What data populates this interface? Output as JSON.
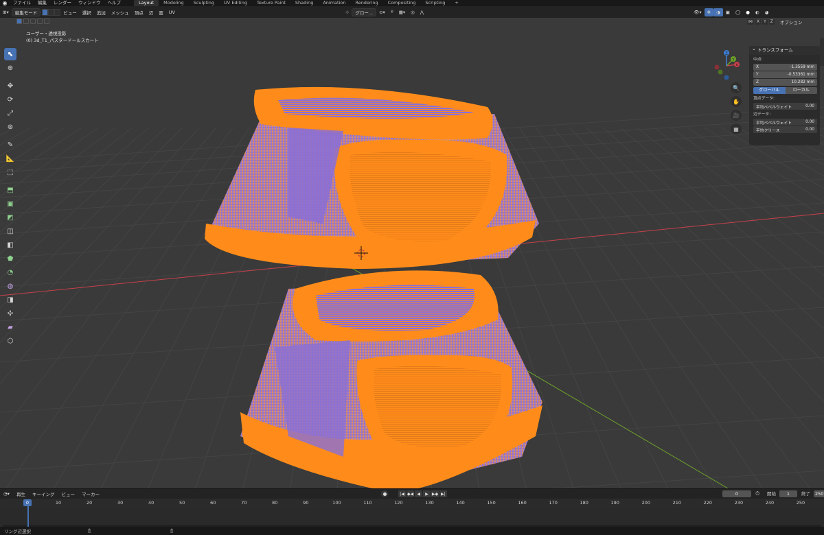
{
  "topbar": {
    "menus": [
      "ファイル",
      "編集",
      "レンダー",
      "ウィンドウ",
      "ヘルプ"
    ],
    "workspaces": [
      "Layout",
      "Modeling",
      "Sculpting",
      "UV Editing",
      "Texture Paint",
      "Shading",
      "Animation",
      "Rendering",
      "Compositing",
      "Scripting",
      "+"
    ],
    "active_workspace": "Layout"
  },
  "header": {
    "mode": "編集モード",
    "menus": [
      "ビュー",
      "選択",
      "追加",
      "メッシュ",
      "頂点",
      "辺",
      "面",
      "UV"
    ],
    "transform_orientation": "グロー...",
    "options_label": "オプション",
    "axes": [
      "X",
      "Y",
      "Z"
    ]
  },
  "viewport": {
    "view_name": "ユーザー・透視投影",
    "object_name": "(0) 3d_T1_パスタードールスカート",
    "colors": {
      "background": "#3a3a3a",
      "mesh_selected": "#ff8c1a",
      "mesh_faces": "#8a6fd6",
      "axis_x": "#c8414b",
      "axis_y": "#6ea32a"
    }
  },
  "toolbar": {
    "tools": [
      "select-box",
      "cursor",
      "move",
      "rotate",
      "scale",
      "transform",
      "annotate",
      "measure",
      "add-cube",
      "extrude",
      "inset",
      "bevel",
      "loop-cut",
      "knife",
      "poly-build",
      "spin",
      "smooth",
      "edge-slide",
      "shrink-fatten",
      "shear",
      "rip"
    ]
  },
  "gizmo": {
    "labels": [
      "X",
      "Y",
      "Z"
    ]
  },
  "npanel": {
    "title": "トランスフォーム",
    "median_label": "中点:",
    "x_label": "X",
    "x_value": "-1.3559 mm",
    "y_label": "Y",
    "y_value": "-0.53361 mm",
    "z_label": "Z",
    "z_value": "10.282 mm",
    "global_label": "グローバル",
    "local_label": "ローカル",
    "vertex_data_label": "頂点データ:",
    "vertex_bevel_label": "平均ベベルウェイト",
    "vertex_bevel_value": "0.00",
    "edge_data_label": "辺データ:",
    "edge_bevel_label": "平均ベベルウェイト",
    "edge_bevel_value": "0.00",
    "edge_crease_label": "平均クリース",
    "edge_crease_value": "0.00"
  },
  "timeline": {
    "menus": [
      "再生",
      "キーイング",
      "ビュー",
      "マーカー"
    ],
    "current_frame": "0",
    "start_label": "開始",
    "start_value": "1",
    "end_label": "終了",
    "end_value": "250",
    "ticks": [
      "0",
      "10",
      "20",
      "30",
      "40",
      "50",
      "60",
      "70",
      "80",
      "90",
      "100",
      "110",
      "120",
      "130",
      "140",
      "150",
      "160",
      "170",
      "180",
      "190",
      "200",
      "210",
      "220",
      "230",
      "240",
      "250"
    ],
    "playhead": "0"
  },
  "statusbar": {
    "text": "リング辺選択"
  }
}
